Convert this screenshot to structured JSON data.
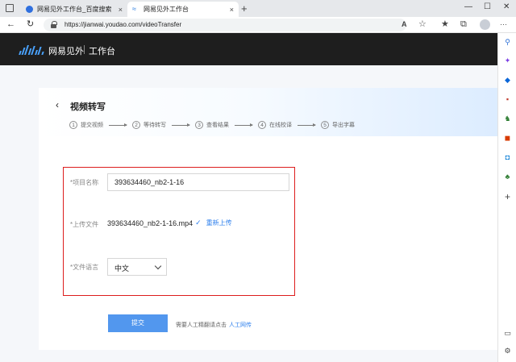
{
  "browser": {
    "tabs": [
      {
        "title": "网易见外工作台_百度搜索",
        "active": false,
        "favicon": "baidu-favicon"
      },
      {
        "title": "网易见外工作台",
        "active": true,
        "favicon": "youdao-favicon"
      }
    ],
    "new_tab_symbol": "+",
    "tab_close_symbol": "×",
    "url": "https://jianwai.youdao.com/videoTransfer",
    "window_controls": {
      "minimize": "—",
      "maximize": "☐",
      "close": "✕"
    },
    "nav_symbols": {
      "back": "←",
      "refresh": "↻"
    },
    "toolbar_symbols": {
      "read_aloud": "A",
      "favorites_add": "☆",
      "favorites": "★",
      "collections": "⧉",
      "more": "···"
    }
  },
  "site": {
    "brand": "网易见外",
    "section": "工作台"
  },
  "page": {
    "back_symbol": "‹",
    "title": "视频转写",
    "steps": [
      {
        "num": "1",
        "label": "提交视频"
      },
      {
        "num": "2",
        "label": "等待转写"
      },
      {
        "num": "3",
        "label": "查看结果"
      },
      {
        "num": "4",
        "label": "在线校译"
      },
      {
        "num": "5",
        "label": "导出字幕"
      }
    ],
    "form": {
      "project_label": "*项目名称",
      "project_value": "393634460_nb2-1-16",
      "file_label": "*上传文件",
      "file_name": "393634460_nb2-1-16.mp4",
      "file_check": "✓",
      "reupload": "重新上传",
      "language_label": "*文件语言",
      "language_value": "中文"
    },
    "submit_label": "提交",
    "hint_text": "需要人工精翻请点击",
    "hint_link": "人工网传"
  },
  "sidebar": {
    "items": [
      {
        "icon": "search-icon",
        "symbol": "⚲",
        "color": "#2b6fd6"
      },
      {
        "icon": "sparkle-icon",
        "symbol": "✦",
        "color": "#7b3fe4"
      },
      {
        "icon": "tag-icon",
        "symbol": "◆",
        "color": "#0a66d8"
      },
      {
        "icon": "toolbox-icon",
        "symbol": "▪",
        "color": "#c0392b"
      },
      {
        "icon": "games-icon",
        "symbol": "♞",
        "color": "#2e7d32"
      },
      {
        "icon": "office-icon",
        "symbol": "◼",
        "color": "#d83b01"
      },
      {
        "icon": "outlook-icon",
        "symbol": "◘",
        "color": "#0078d4"
      },
      {
        "icon": "tree-icon",
        "symbol": "♣",
        "color": "#2e7d32"
      },
      {
        "icon": "add-icon",
        "symbol": "+",
        "color": "#444444"
      },
      {
        "icon": "split-screen-icon",
        "symbol": "▭",
        "color": "#444444"
      },
      {
        "icon": "settings-icon",
        "symbol": "⚙",
        "color": "#444444"
      }
    ]
  }
}
